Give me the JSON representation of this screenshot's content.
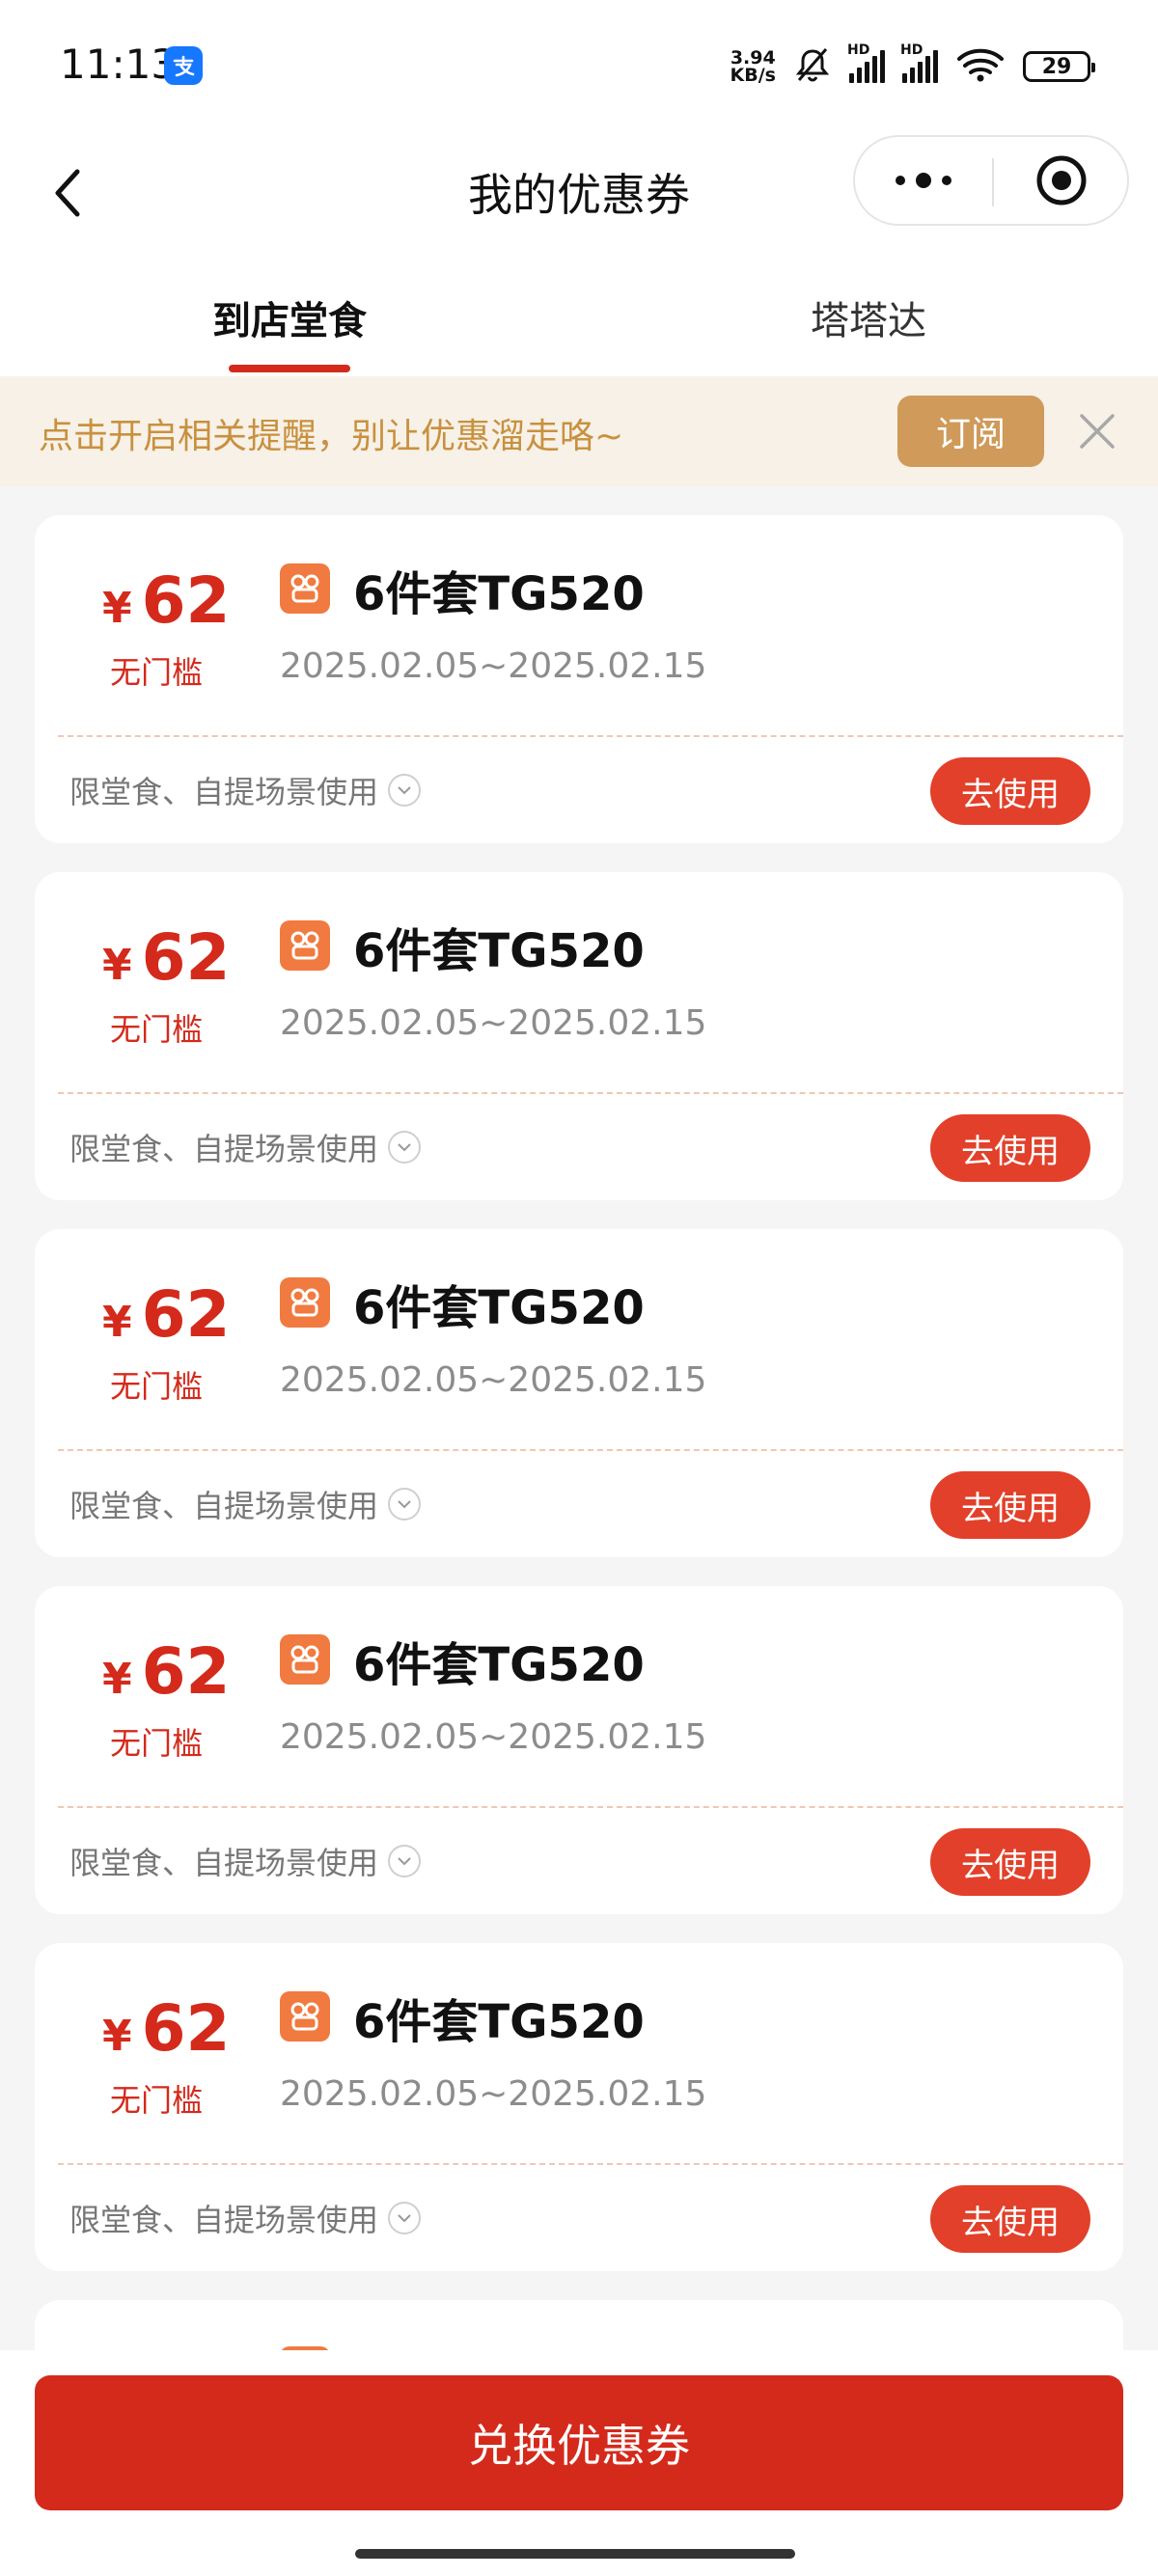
{
  "status_bar": {
    "time": "11:13",
    "net_speed_value": "3.94",
    "net_speed_unit": "KB/s",
    "battery": "29"
  },
  "nav": {
    "title": "我的优惠券"
  },
  "tabs": [
    {
      "label": "到店堂食",
      "active": true
    },
    {
      "label": "塔塔达",
      "active": false
    }
  ],
  "banner": {
    "text": "点击开启相关提醒，别让优惠溜走咯~",
    "button_label": "订阅"
  },
  "coupons": [
    {
      "currency": "¥",
      "amount": "62",
      "threshold": "无门槛",
      "title": "6件套TG520",
      "date_range": "2025.02.05~2025.02.15",
      "scope": "限堂食、自提场景使用",
      "button_label": "去使用"
    },
    {
      "currency": "¥",
      "amount": "62",
      "threshold": "无门槛",
      "title": "6件套TG520",
      "date_range": "2025.02.05~2025.02.15",
      "scope": "限堂食、自提场景使用",
      "button_label": "去使用"
    },
    {
      "currency": "¥",
      "amount": "62",
      "threshold": "无门槛",
      "title": "6件套TG520",
      "date_range": "2025.02.05~2025.02.15",
      "scope": "限堂食、自提场景使用",
      "button_label": "去使用"
    },
    {
      "currency": "¥",
      "amount": "62",
      "threshold": "无门槛",
      "title": "6件套TG520",
      "date_range": "2025.02.05~2025.02.15",
      "scope": "限堂食、自提场景使用",
      "button_label": "去使用"
    },
    {
      "currency": "¥",
      "amount": "62",
      "threshold": "无门槛",
      "title": "6件套TG520",
      "date_range": "2025.02.05~2025.02.15",
      "scope": "限堂食、自提场景使用",
      "button_label": "去使用"
    }
  ],
  "bottom": {
    "redeem_label": "兑换优惠券"
  },
  "colors": {
    "brand_red": "#d42a1c",
    "button_red": "#e2402a",
    "banner_bg": "#f7f1e7",
    "banner_text": "#c8913f",
    "subscribe_bg": "#cf9a5a"
  },
  "icons": [
    "back-icon",
    "more-icon",
    "close-app-icon",
    "close-icon",
    "coupon-brand-icon",
    "chevron-down-icon",
    "wifi-icon",
    "signal-icon",
    "mute-icon",
    "alipay-icon"
  ]
}
